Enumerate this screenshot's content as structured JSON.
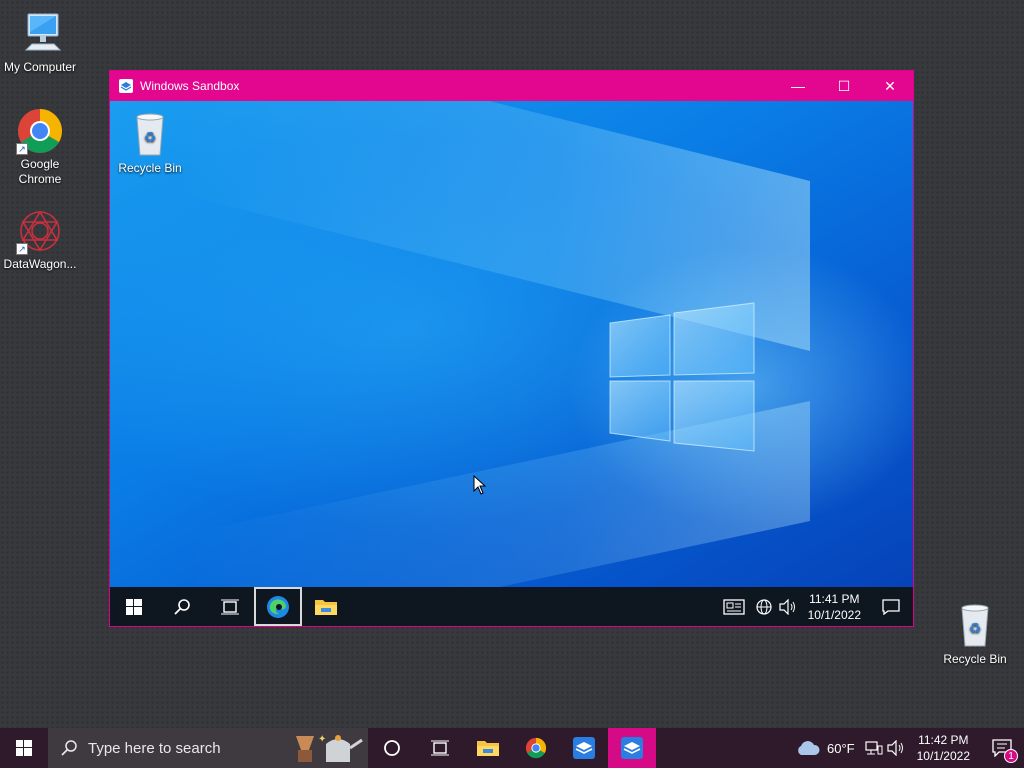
{
  "host_desktop": {
    "icons": [
      {
        "label": "My Computer"
      },
      {
        "label": "Google\nChrome"
      },
      {
        "label": "DataWagon..."
      },
      {
        "label": "Recycle Bin"
      }
    ]
  },
  "sandbox": {
    "title": "Windows Sandbox",
    "controls": {
      "minimize": "—",
      "maximize": "☐",
      "close": "✕"
    },
    "desktop": {
      "recycle_bin_label": "Recycle Bin"
    },
    "taskbar": {
      "time": "11:41 PM",
      "date": "10/1/2022"
    }
  },
  "host_taskbar": {
    "search_placeholder": "Type here to search",
    "weather": "60°F",
    "time": "11:42 PM",
    "date": "10/1/2022",
    "notification_count": "1"
  },
  "colors": {
    "sandbox_accent": "#e3068f",
    "host_taskbar": "#2f1a2c"
  }
}
